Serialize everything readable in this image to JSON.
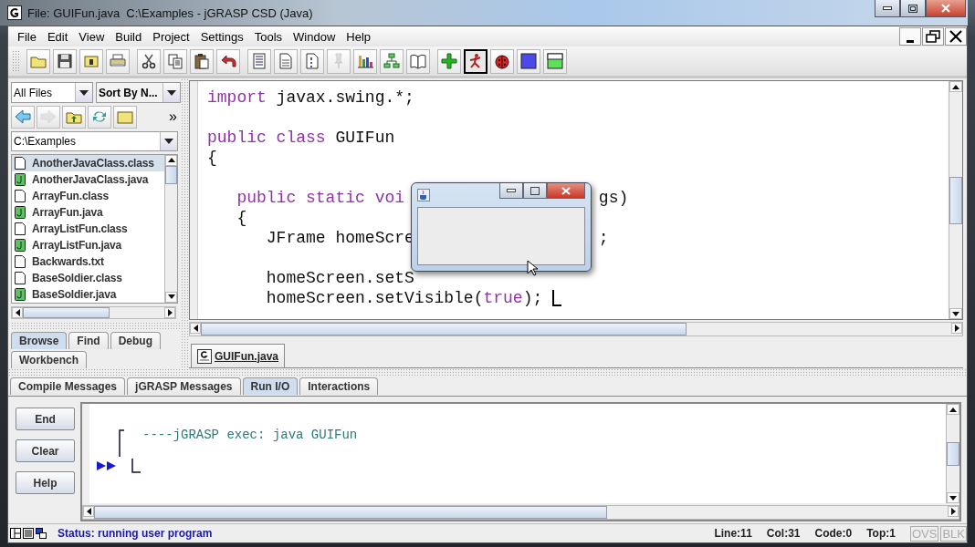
{
  "window": {
    "title": "File: GUIFun.java  C:\\Examples - jGRASP CSD (Java)"
  },
  "menu": [
    "File",
    "Edit",
    "View",
    "Build",
    "Project",
    "Settings",
    "Tools",
    "Window",
    "Help"
  ],
  "toolbar": [
    [
      {
        "disabled": false,
        "pressed": false
      },
      {
        "disabled": false,
        "pressed": false
      },
      {
        "disabled": false,
        "pressed": false
      },
      {
        "disabled": false,
        "pressed": false
      }
    ],
    [
      {
        "disabled": false,
        "pressed": false
      },
      {
        "disabled": false,
        "pressed": false
      },
      {
        "disabled": false,
        "pressed": false
      },
      {
        "disabled": false,
        "pressed": false
      }
    ],
    [
      {
        "disabled": false,
        "pressed": false
      },
      {
        "disabled": false,
        "pressed": false
      },
      {
        "disabled": false,
        "pressed": false
      },
      {
        "disabled": true,
        "pressed": false
      },
      {
        "disabled": false,
        "pressed": false
      },
      {
        "disabled": false,
        "pressed": false
      },
      {
        "disabled": false,
        "pressed": false
      }
    ],
    [
      {
        "disabled": false,
        "pressed": false
      },
      {
        "disabled": false,
        "pressed": true
      },
      {
        "disabled": false,
        "pressed": false
      },
      {
        "disabled": false,
        "pressed": false
      },
      {
        "disabled": false,
        "pressed": false
      }
    ]
  ],
  "browser": {
    "filter": "All Files",
    "sort": "Sort By N...",
    "nav": [
      {
        "disabled": false
      },
      {
        "disabled": true
      },
      {
        "disabled": false
      },
      {
        "disabled": false
      },
      {
        "disabled": false
      }
    ],
    "more": "»",
    "path": "C:\\Examples",
    "files": [
      {
        "name": "AnotherJavaClass.class",
        "kind": "class",
        "selected": true
      },
      {
        "name": "AnotherJavaClass.java",
        "kind": "java",
        "selected": false
      },
      {
        "name": "ArrayFun.class",
        "kind": "class",
        "selected": false
      },
      {
        "name": "ArrayFun.java",
        "kind": "java",
        "selected": false
      },
      {
        "name": "ArrayListFun.class",
        "kind": "class",
        "selected": false
      },
      {
        "name": "ArrayListFun.java",
        "kind": "java",
        "selected": false
      },
      {
        "name": "Backwards.txt",
        "kind": "text",
        "selected": false
      },
      {
        "name": "BaseSoldier.class",
        "kind": "class",
        "selected": false
      },
      {
        "name": "BaseSoldier.java",
        "kind": "java",
        "selected": false
      }
    ],
    "tabs": [
      {
        "label": "Browse",
        "selected": true
      },
      {
        "label": "Find",
        "selected": false
      },
      {
        "label": "Debug",
        "selected": false
      },
      {
        "label": "Workbench",
        "selected": false
      }
    ]
  },
  "editor": {
    "blocks": [
      [
        {
          "segments": [
            {
              "text": "import",
              "kind": "keyword"
            },
            {
              "text": " javax.swing.*;",
              "kind": "plain"
            }
          ]
        }
      ],
      [
        {
          "segments": [
            {
              "text": "public class",
              "kind": "keyword"
            },
            {
              "text": " GUIFun",
              "kind": "plain"
            }
          ]
        },
        {
          "segments": [
            {
              "text": "{",
              "kind": "plain"
            }
          ]
        }
      ],
      [
        {
          "segments": [
            {
              "text": "   public static voi",
              "kind": "keyword"
            }
          ],
          "tail": [
            {
              "text": "gs)",
              "kind": "plain"
            }
          ]
        },
        {
          "segments": [
            {
              "text": "   {",
              "kind": "plain"
            }
          ]
        },
        {
          "segments": [
            {
              "text": "      JFrame homeScre",
              "kind": "plain"
            }
          ],
          "tail": [
            {
              "text": ";",
              "kind": "plain"
            }
          ]
        }
      ],
      [
        {
          "segments": [
            {
              "text": "      homeScreen.setS",
              "kind": "plain"
            }
          ]
        },
        {
          "segments": [
            {
              "text": "      homeScreen.setVisible(",
              "kind": "plain"
            },
            {
              "text": "true",
              "kind": "keyword"
            },
            {
              "text": ");",
              "kind": "plain"
            }
          ],
          "caret": true
        }
      ]
    ],
    "tabs": [
      {
        "label": "GUIFun.java",
        "selected": true
      }
    ]
  },
  "messages": {
    "tabs": [
      {
        "label": "Compile Messages",
        "selected": false
      },
      {
        "label": "jGRASP Messages",
        "selected": false
      },
      {
        "label": "Run I/O",
        "selected": true
      },
      {
        "label": "Interactions",
        "selected": false
      }
    ],
    "buttons": [
      "End",
      "Clear",
      "Help"
    ],
    "output": "----jGRASP exec: java GUIFun"
  },
  "status": {
    "text": "Status: running user program",
    "fields": [
      "Line:11",
      "Col:31",
      "Code:0",
      "Top:1"
    ],
    "modes": [
      {
        "label": "OVS",
        "on": false
      },
      {
        "label": "BLK",
        "on": false
      }
    ]
  }
}
